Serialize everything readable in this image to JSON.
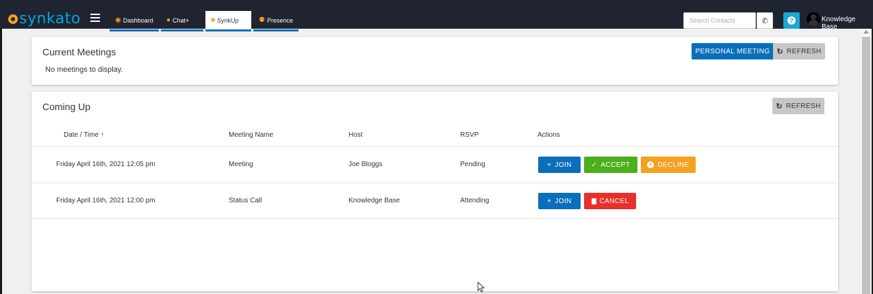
{
  "app": {
    "logo_text": "synkato",
    "colors": {
      "topbar": "#1f2430",
      "brand_blue": "#00a7e1",
      "brand_orange": "#f6a21e",
      "primary": "#0a6fba"
    }
  },
  "nav": {
    "tabs": [
      {
        "label": "Dashboard",
        "icon": "dashboard-icon"
      },
      {
        "label": "Chat+",
        "icon": "chat-icon"
      },
      {
        "label": "SynkUp",
        "icon": "video-icon",
        "active": true
      },
      {
        "label": "Presence",
        "icon": "people-icon"
      }
    ]
  },
  "header": {
    "search_placeholder": "Search Contacts",
    "phone_icon": "phone-icon",
    "help_icon": "help-icon",
    "help_glyph": "?",
    "user_name": "Knowledge Base"
  },
  "current_meetings": {
    "title": "Current Meetings",
    "empty_text": "No meetings to display.",
    "personal_meeting_label": "PERSONAL MEETING",
    "refresh_label": "REFRESH"
  },
  "coming_up": {
    "title": "Coming Up",
    "refresh_label": "REFRESH",
    "columns": [
      "Date / Time ↑",
      "Meeting Name",
      "Host",
      "RSVP",
      "Actions"
    ],
    "rows": [
      {
        "date": "Friday April 16th, 2021 12:05 pm",
        "name": "Meeting",
        "host": "Joe Bloggs",
        "rsvp": "Pending",
        "join_label": "JOIN",
        "accept_label": "ACCEPT",
        "decline_label": "DECLINE"
      },
      {
        "date": "Friday April 16th, 2021 12:00 pm",
        "name": "Status Call",
        "host": "Knowledge Base",
        "rsvp": "Attending",
        "join_label": "JOIN",
        "cancel_label": "CANCEL"
      }
    ]
  }
}
